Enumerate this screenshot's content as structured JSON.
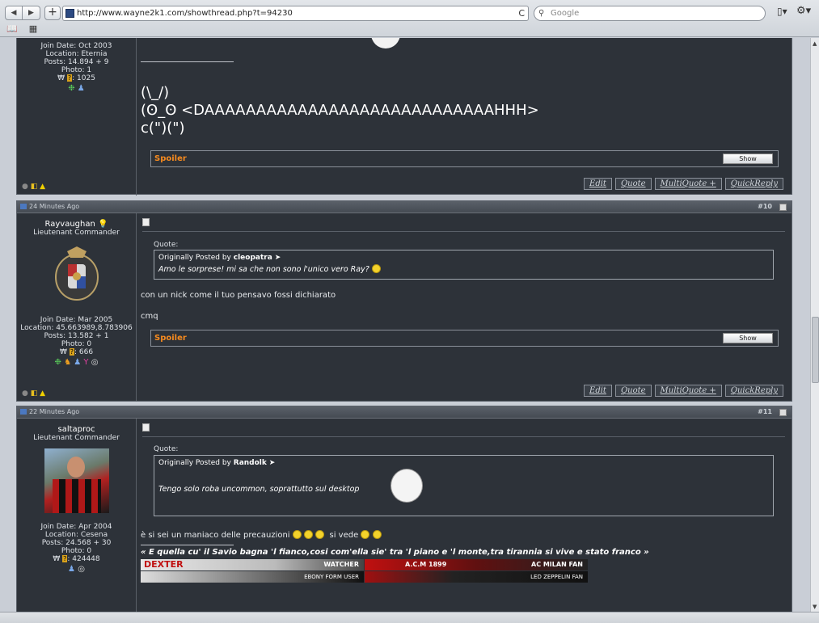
{
  "browser": {
    "url": "http://www.wayne2k1.com/showthread.php?t=94230",
    "search_placeholder": "Google",
    "back": "◀",
    "forward": "▶",
    "add": "+",
    "reload": "C"
  },
  "posts": [
    {
      "user": {
        "join_date": "Join Date: Oct 2003",
        "location": "Location: Eternia",
        "posts": "Posts: 14.894 + 9",
        "photo": "Photo: 1",
        "points": "1025"
      },
      "ascii": [
        "(\\_/)",
        "(ʘ_ʘ <DAAAAAAAAAAAAAAAAAAAAAAAAAAAAHHH>",
        "c(\")(\")"
      ],
      "spoiler": "Spoiler",
      "show": "Show",
      "actions": [
        "Edit",
        "Quote",
        "MultiQuote +",
        "QuickReply"
      ]
    },
    {
      "time": "24 Minutes Ago",
      "number": "#10",
      "user": {
        "name": "Rayvaughan",
        "rank": "Lieutenant Commander",
        "join_date": "Join Date: Mar 2005",
        "location": "Location: 45.663989,8.783906",
        "posts": "Posts: 13.582 + 1",
        "photo": "Photo: 0",
        "points": "666"
      },
      "quote_label": "Quote:",
      "quote_by_prefix": "Originally Posted by",
      "quote_author": "cleopatra",
      "quote_text": "Amo le sorprese! mi sa che non sono l'unico vero Ray?",
      "body1": "con un nick come il tuo pensavo fossi dichiarato",
      "body2": "cmq",
      "spoiler": "Spoiler",
      "show": "Show",
      "actions": [
        "Edit",
        "Quote",
        "MultiQuote +",
        "QuickReply"
      ]
    },
    {
      "time": "22 Minutes Ago",
      "number": "#11",
      "user": {
        "name": "saltaproc",
        "rank": "Lieutenant Commander",
        "join_date": "Join Date: Apr 2004",
        "location": "Location: Cesena",
        "posts": "Posts: 24.568 + 30",
        "photo": "Photo: 0",
        "points": "424448"
      },
      "quote_label": "Quote:",
      "quote_by_prefix": "Originally Posted by",
      "quote_author": "Randolk",
      "quote_text": "Tengo solo roba uncommon, soprattutto sul desktop",
      "body": "è si sei un maniaco delle precauzioni",
      "body_suffix": "si vede",
      "signature": "« E quella cu' il Savio bagna 'l fianco,cosi com'ella sie' tra 'l piano e 'l monte,tra tirannia si vive e stato franco »",
      "banners": [
        "DEXTER",
        "WATCHER",
        "A.C.M 1899",
        "AC MILAN FAN",
        "EBONY FORM USER",
        "LED ZEPPELIN FAN"
      ]
    }
  ],
  "colors": {
    "spoiler": "#f58a1f",
    "post_bg": "#2d3239",
    "header_bg": "#4f555d"
  }
}
